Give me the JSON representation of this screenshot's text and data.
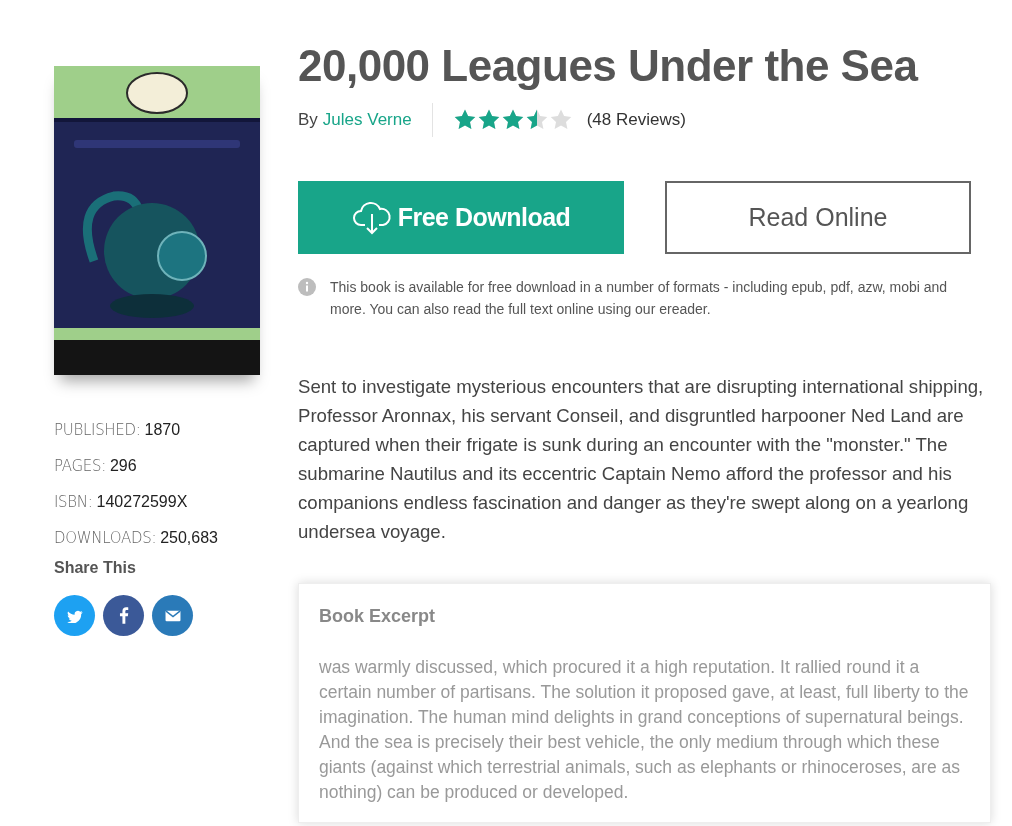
{
  "details": [
    {
      "label": "PUBLISHED:",
      "value": "1870"
    },
    {
      "label": "PAGES:",
      "value": "296"
    },
    {
      "label": "ISBN:",
      "value": "140272599X"
    },
    {
      "label": "DOWNLOADS:",
      "value": "250,683"
    }
  ],
  "share": {
    "heading": "Share This",
    "buttons": [
      {
        "kind": "twitter",
        "color": "#1da1f2"
      },
      {
        "kind": "facebook",
        "color": "#3b5998"
      },
      {
        "kind": "email",
        "color": "#2a7ab8"
      }
    ]
  },
  "book": {
    "title": "20,000 Leagues Under the Sea",
    "by": "By",
    "author": "Jules Verne",
    "stars": 3.5,
    "reviews": "(48 Reviews)"
  },
  "buttons": [
    {
      "kind": "download",
      "label": "Free Download"
    },
    {
      "kind": "read",
      "label": "Read Online"
    }
  ],
  "notice": "This book is available for free download in a number of formats - including epub, pdf, azw, mobi and more. You can also read the full text online using our ereader.",
  "description": "Sent to investigate mysterious encounters that are disrupting international shipping, Professor Aronnax, his servant Conseil, and disgruntled harpooner Ned Land are captured when their frigate is sunk during an encounter with the \"monster.\" The submarine Nautilus and its eccentric Captain Nemo afford the professor and his companions endless fascination and danger as they're swept along on a yearlong undersea voyage.",
  "excerpt": {
    "heading": "Book Excerpt",
    "text": "was warmly discussed, which procured it a high reputation. It rallied round it a certain number of partisans. The solution it proposed gave, at least, full liberty to the imagination. The human mind delights in grand conceptions of supernatural beings. And the sea is precisely their best vehicle, the only medium through which these giants (against which terrestrial animals, such as elephants or rhinoceroses, are as nothing) can be produced or developed."
  }
}
